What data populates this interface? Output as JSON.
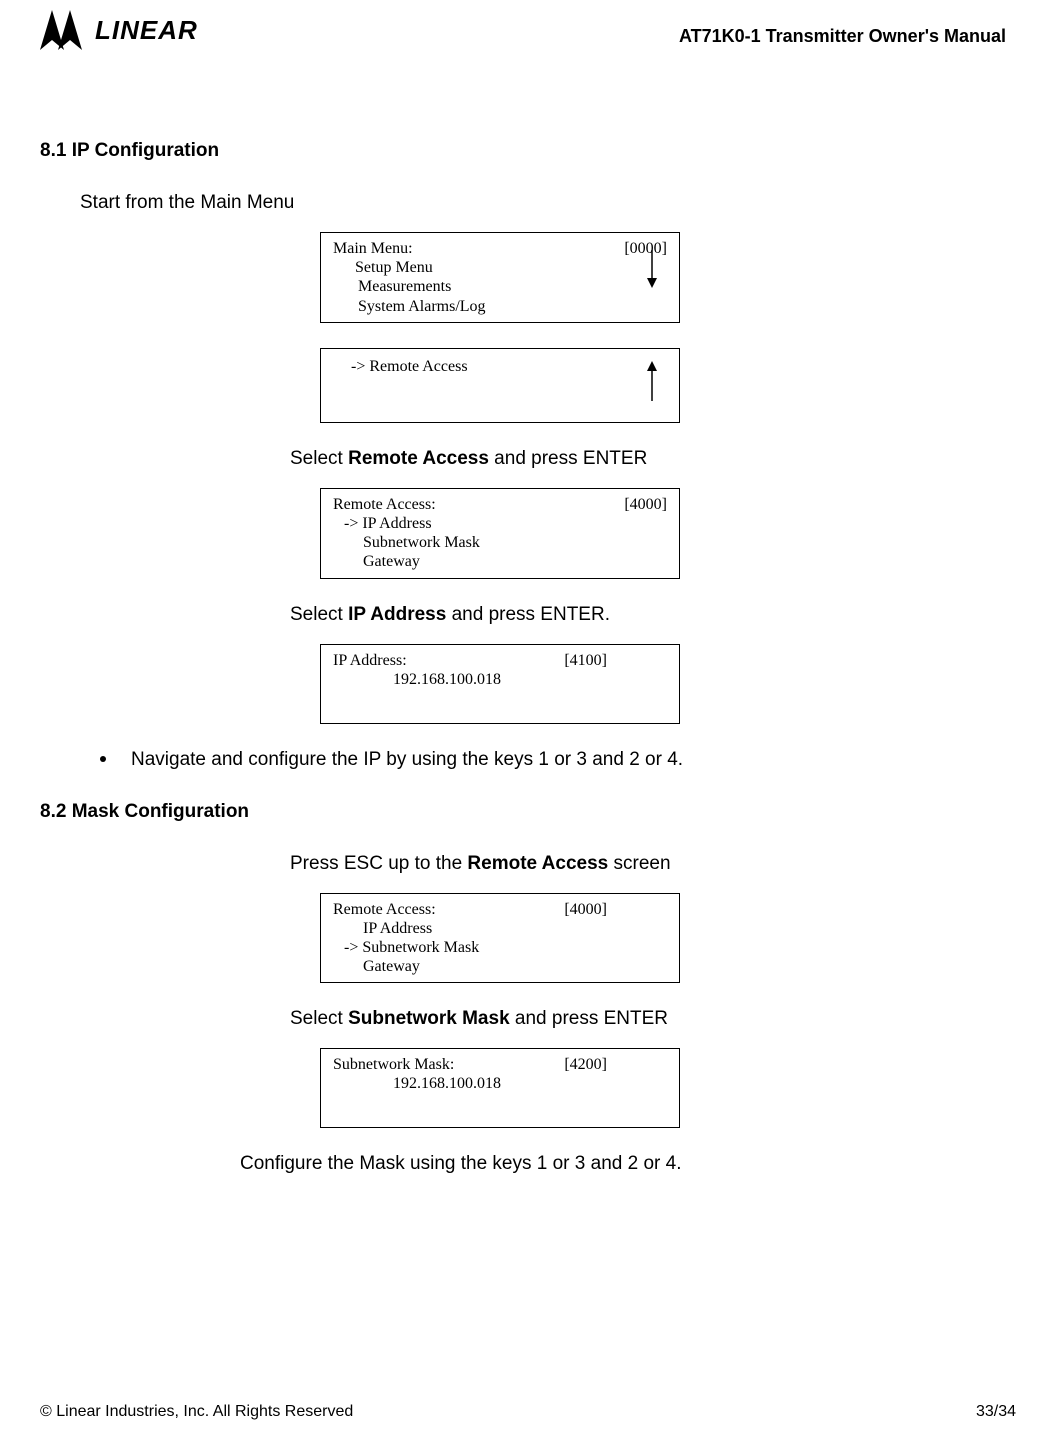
{
  "header": {
    "logo_text": "LINEAR",
    "manual_title": "AT71K0-1 Transmitter Owner's Manual"
  },
  "section_8_1": {
    "title": "8.1 IP Configuration",
    "intro": "Start from the Main Menu",
    "screen1": {
      "title": "Main Menu:",
      "code": "[0000]",
      "line1": "Setup Menu",
      "line2": "Measurements",
      "line3": "System Alarms/Log"
    },
    "screen2": {
      "line1": "-> Remote Access"
    },
    "step1_pre": "Select ",
    "step1_bold": "Remote Access",
    "step1_post": " and press ENTER",
    "screen3": {
      "title": "Remote Access:",
      "code": "[4000]",
      "line1": "-> IP Address",
      "line2": "Subnetwork Mask",
      "line3": "Gateway"
    },
    "step2_pre": "Select ",
    "step2_bold": "IP Address",
    "step2_post": " and press ENTER.",
    "screen4": {
      "title": "IP Address:",
      "code": "[4100]",
      "value": "192.168.100.018"
    },
    "bullet_text": "Navigate and configure the IP by using the keys 1 or 3 and  2 or 4."
  },
  "section_8_2": {
    "title": "8.2 Mask Configuration",
    "intro_pre": "Press ESC up to the ",
    "intro_bold": "Remote Access",
    "intro_post": " screen",
    "screen1": {
      "title": "Remote Access:",
      "code": "[4000]",
      "line1": "IP Address",
      "line2": "-> Subnetwork Mask",
      "line3": "Gateway"
    },
    "step1_pre": "Select ",
    "step1_bold": "Subnetwork Mask",
    "step1_post": " and press ENTER",
    "screen2": {
      "title": "Subnetwork Mask:",
      "code": "[4200]",
      "value": "192.168.100.018"
    },
    "final": "Configure the Mask using the keys 1 or 3 and  2 or 4."
  },
  "footer": {
    "copyright": "© Linear Industries, Inc. All Rights Reserved",
    "page": "33/34"
  }
}
